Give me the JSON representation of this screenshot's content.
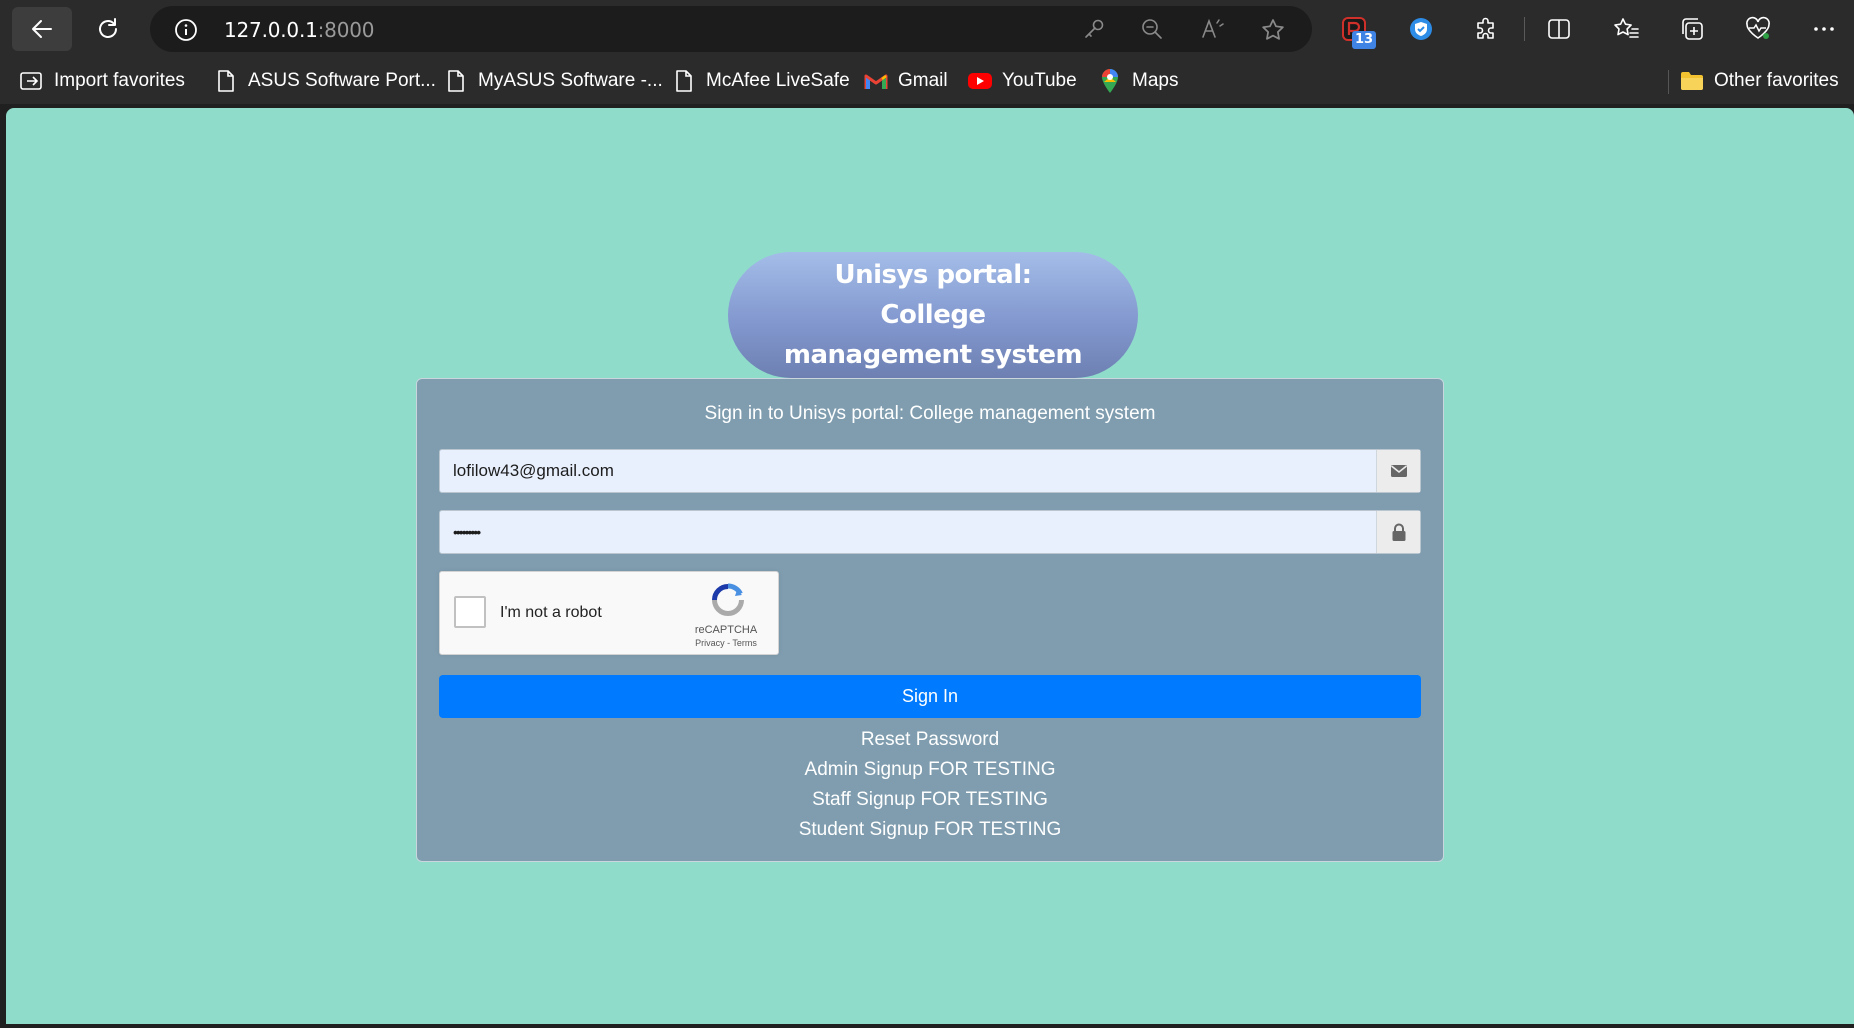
{
  "browser": {
    "url_host": "127.0.0.1",
    "url_port": ":8000",
    "extension_badge": "13",
    "icons": [
      "back-arrow-icon",
      "reload-icon",
      "info-icon",
      "key-icon",
      "zoom-out-icon",
      "read-aloud-icon",
      "star-icon",
      "extension-icon",
      "puzzle-icon",
      "split-screen-icon",
      "favorites-icon",
      "collections-icon",
      "health-icon",
      "more-icon"
    ]
  },
  "bookmarks": {
    "items": [
      {
        "label": "Import favorites",
        "icon": "import-icon"
      },
      {
        "label": "ASUS Software Port...",
        "icon": "page-icon"
      },
      {
        "label": "MyASUS Software -...",
        "icon": "page-icon"
      },
      {
        "label": "McAfee LiveSafe",
        "icon": "page-icon"
      },
      {
        "label": "Gmail",
        "icon": "gmail-icon"
      },
      {
        "label": "YouTube",
        "icon": "youtube-icon"
      },
      {
        "label": "Maps",
        "icon": "maps-icon"
      }
    ],
    "other": "Other favorites"
  },
  "page": {
    "title": "Unisys portal: College management system",
    "card_heading": "Sign in to Unisys portal: College management system",
    "email_value": "lofilow43@gmail.com",
    "password_value": "•••••••••",
    "recaptcha": {
      "label": "I'm not a robot",
      "brand": "reCAPTCHA",
      "links": "Privacy - Terms"
    },
    "signin_label": "Sign In",
    "links": [
      "Reset Password",
      "Admin Signup FOR TESTING",
      "Staff Signup FOR TESTING",
      "Student Signup FOR TESTING"
    ]
  },
  "colors": {
    "page_bg": "#8fdccb",
    "card_bg": "#7f9daf",
    "primary": "#007bff",
    "chrome_bg": "#2b2b2b"
  }
}
